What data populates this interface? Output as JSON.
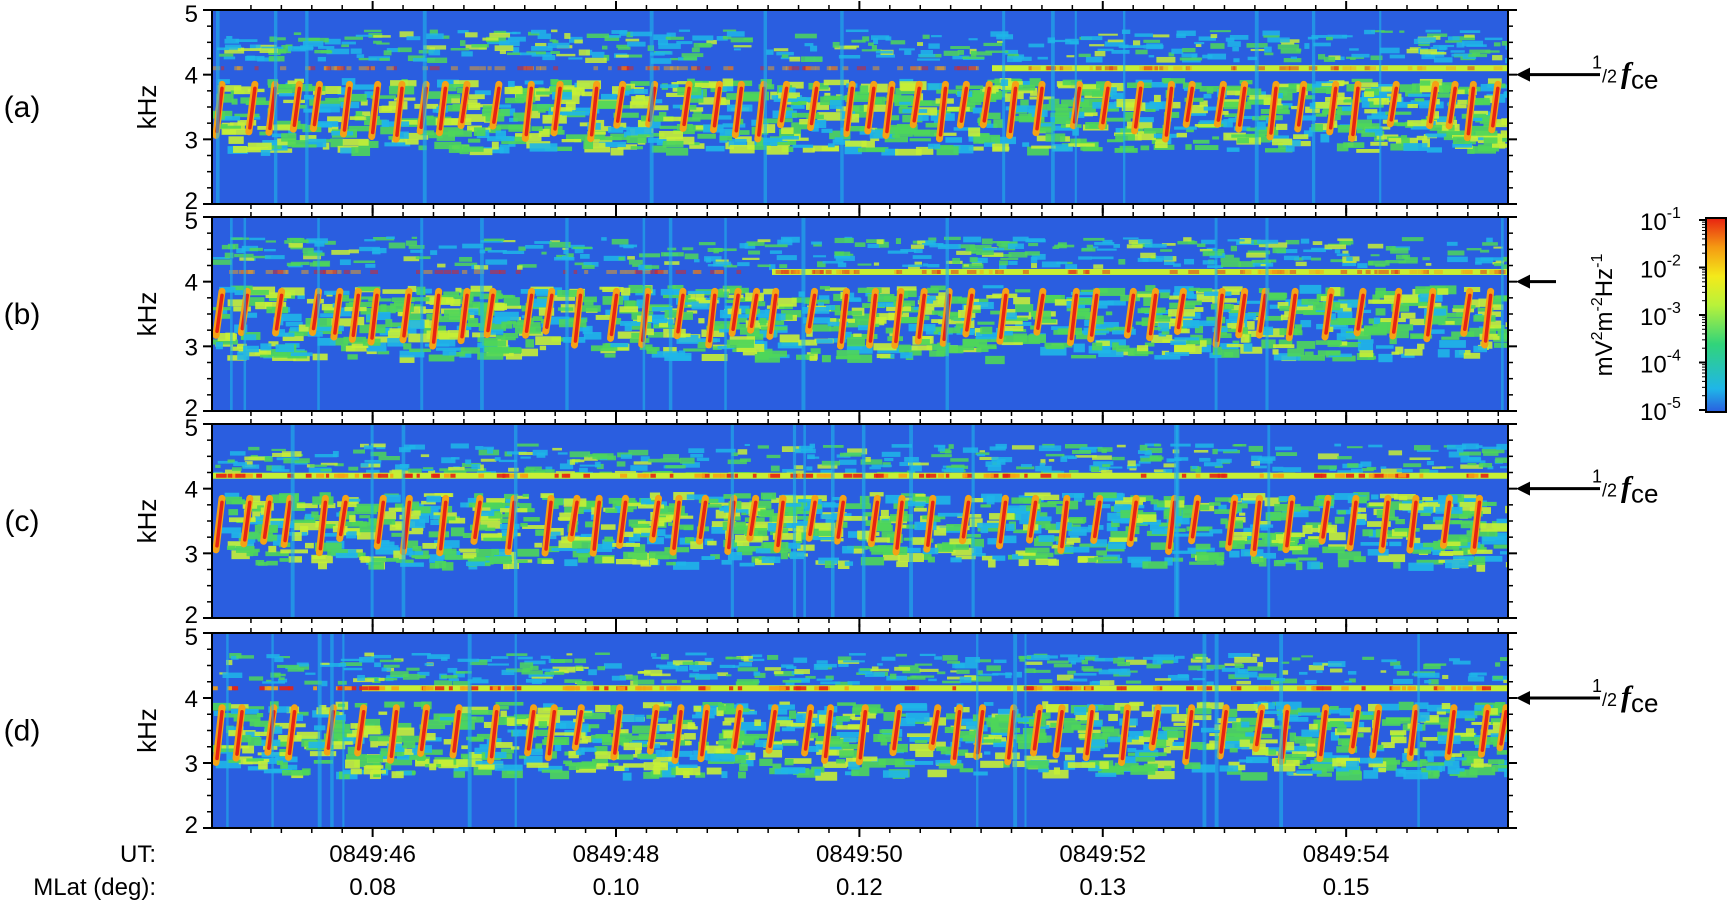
{
  "chart_data": {
    "type": "heatmap",
    "description_kind": "multi-panel spectrogram",
    "panels": [
      {
        "label": "(a)",
        "ylabel": "kHz",
        "yticks": [
          "5",
          "4",
          "3",
          "2"
        ],
        "ylim": [
          2,
          5
        ],
        "annotation": {
          "num": "1",
          "den": "2",
          "symbol": "f",
          "sub": "ce"
        },
        "half_fce_khz": 4.1
      },
      {
        "label": "(b)",
        "ylabel": "kHz",
        "yticks": [
          "5",
          "4",
          "3",
          "2"
        ],
        "ylim": [
          2,
          5
        ],
        "annotation": null,
        "half_fce_khz": 4.15
      },
      {
        "label": "(c)",
        "ylabel": "kHz",
        "yticks": [
          "5",
          "4",
          "3",
          "2"
        ],
        "ylim": [
          2,
          5
        ],
        "annotation": {
          "num": "1",
          "den": "2",
          "symbol": "f",
          "sub": "ce"
        },
        "half_fce_khz": 4.2
      },
      {
        "label": "(d)",
        "ylabel": "kHz",
        "yticks": [
          "5",
          "4",
          "3",
          "2"
        ],
        "ylim": [
          2,
          5
        ],
        "annotation": {
          "num": "1",
          "den": "2",
          "symbol": "f",
          "sub": "ce"
        },
        "half_fce_khz": 4.15
      }
    ],
    "x_axis": {
      "row_labels": [
        "UT:",
        "MLat (deg):"
      ],
      "ticks": [
        {
          "ut": "0849:46",
          "mlat": "0.08"
        },
        {
          "ut": "0849:48",
          "mlat": "0.10"
        },
        {
          "ut": "0849:50",
          "mlat": "0.12"
        },
        {
          "ut": "0849:52",
          "mlat": "0.13"
        },
        {
          "ut": "0849:54",
          "mlat": "0.15"
        }
      ]
    },
    "colorbar": {
      "label": "mV²m⁻²Hz⁻¹",
      "label_parts": {
        "base1": "mV",
        "exp1": "2",
        "base2": "m",
        "exp2": "-2",
        "base3": "Hz",
        "exp3": "-1"
      },
      "ticks": [
        {
          "base": "10",
          "exp": "-1"
        },
        {
          "base": "10",
          "exp": "-2"
        },
        {
          "base": "10",
          "exp": "-3"
        },
        {
          "base": "10",
          "exp": "-4"
        },
        {
          "base": "10",
          "exp": "-5"
        }
      ],
      "scale": "log",
      "range": [
        1e-05,
        0.1
      ],
      "colors": [
        "#2a5ee0",
        "#1fb6e8",
        "#31d47a",
        "#b8f23a",
        "#f4ea1a",
        "#f59a12",
        "#e82211"
      ]
    },
    "colors": {
      "background": "#2a5ee0",
      "weak": "#1fb6e8",
      "green": "#4ed65a",
      "yellow_green": "#c7ef35",
      "orange": "#f5a214",
      "red": "#e62314"
    }
  }
}
